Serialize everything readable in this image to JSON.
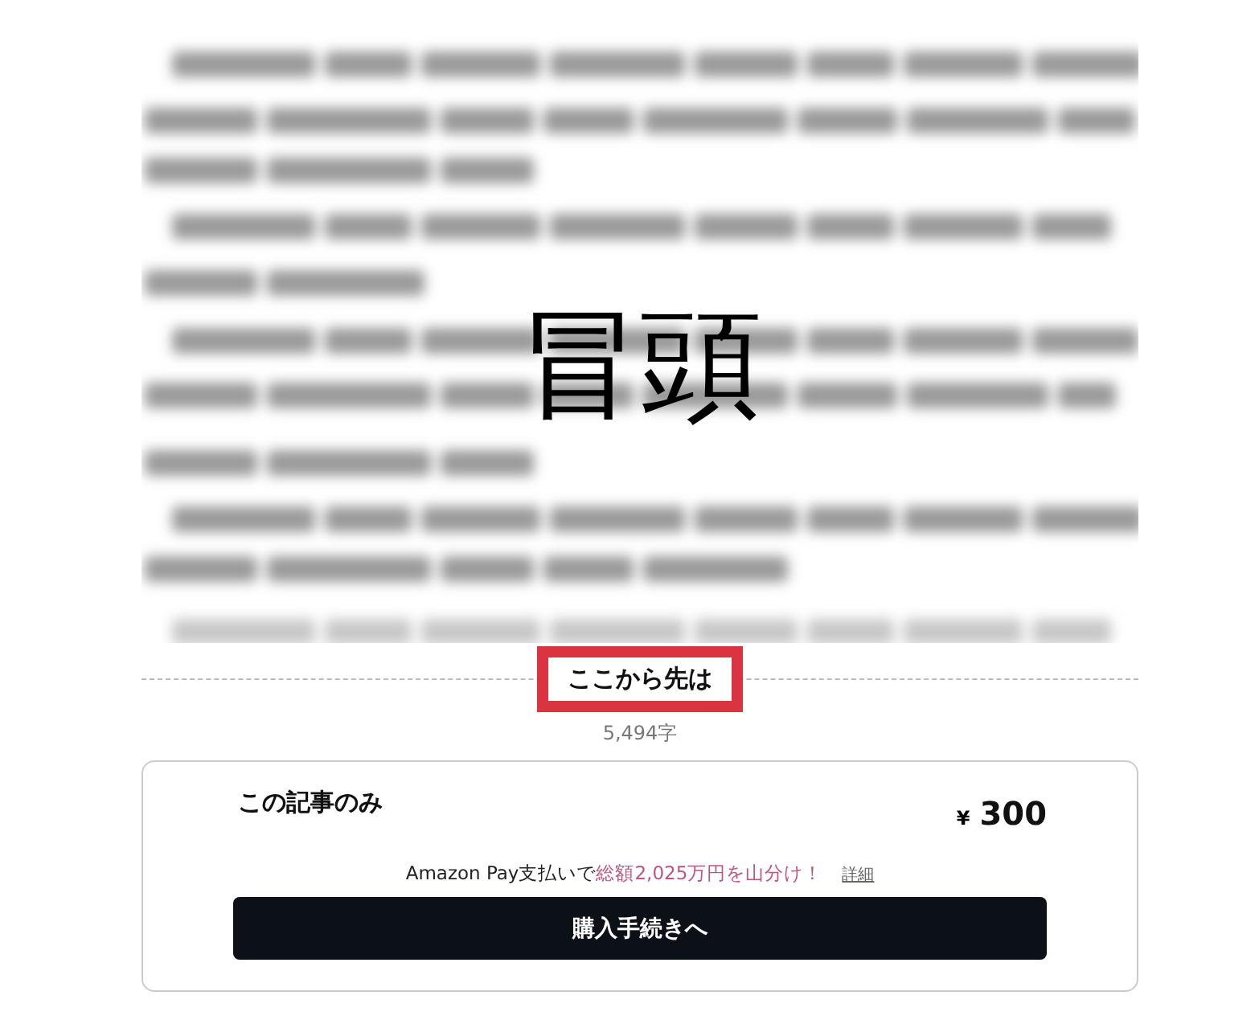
{
  "overlay_label": "冒頭",
  "paywall": {
    "label": "ここから先は",
    "highlighted": true,
    "count": "5,494字"
  },
  "plan": {
    "title": "この記事のみ",
    "currency": "¥",
    "price": "300",
    "promo_text": "Amazon Pay支払いで",
    "promo_highlight": "総額2,025万円を山分け！",
    "details_link": "詳細",
    "button": "購入手続きへ"
  }
}
